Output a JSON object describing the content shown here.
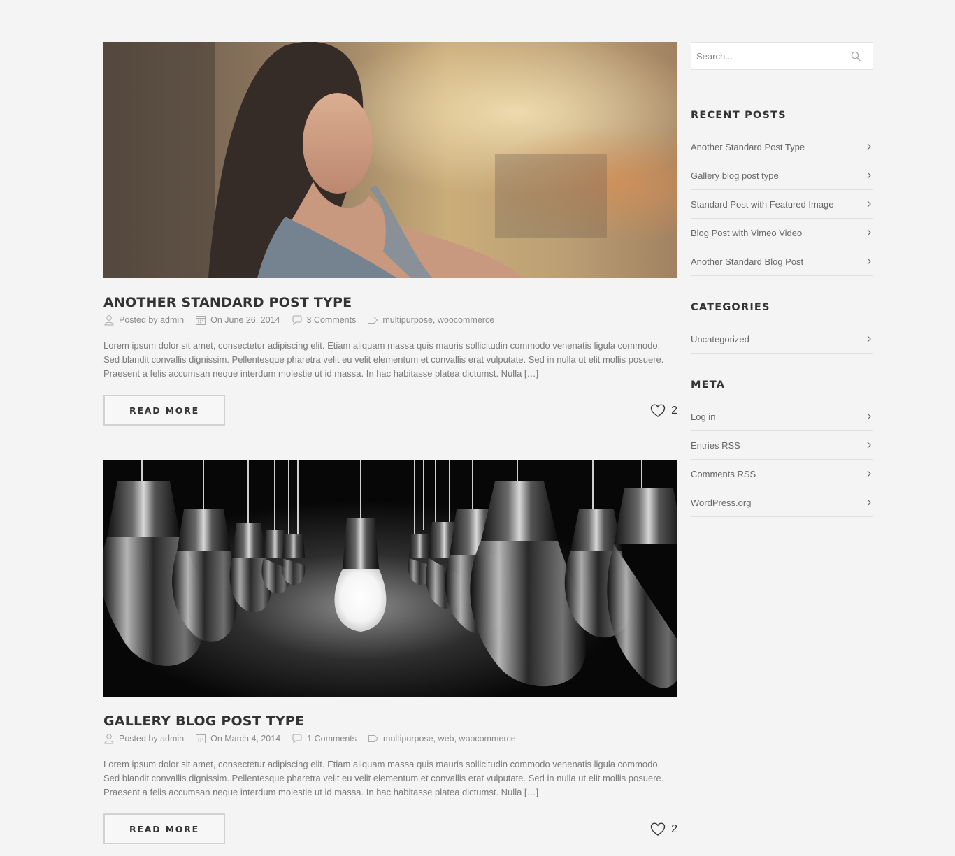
{
  "posts": [
    {
      "title": "Another Standard Post Type",
      "author": "Posted by admin",
      "date": "On June 26, 2014",
      "comments": "3 Comments",
      "tags": "multipurpose, woocommerce",
      "excerpt": "Lorem ipsum dolor sit amet, consectetur adipiscing elit. Etiam aliquam massa quis mauris sollicitudin commodo venenatis ligula commodo. Sed blandit convallis dignissim. Pellentesque pharetra velit eu velit elementum et convallis erat vulputate. Sed in nulla ut elit mollis posuere. Praesent a felis accumsan neque interdum molestie ut id massa. In hac habitasse platea dictumst. Nulla […]",
      "read_more": "READ MORE",
      "likes": "2"
    },
    {
      "title": "Gallery Blog Post Type",
      "author": "Posted by admin",
      "date": "On March 4, 2014",
      "comments": "1 Comments",
      "tags": "multipurpose, web, woocommerce",
      "excerpt": "Lorem ipsum dolor sit amet, consectetur adipiscing elit. Etiam aliquam massa quis mauris sollicitudin commodo venenatis ligula commodo. Sed blandit convallis dignissim. Pellentesque pharetra velit eu velit elementum et convallis erat vulputate. Sed in nulla ut elit mollis posuere. Praesent a felis accumsan neque interdum molestie ut id massa. In hac habitasse platea dictumst. Nulla […]",
      "read_more": "READ MORE",
      "likes": "2"
    }
  ],
  "sidebar": {
    "search_placeholder": "Search...",
    "recent_posts": {
      "title": "Recent Posts",
      "items": [
        "Another Standard Post Type",
        "Gallery blog post type",
        "Standard Post with Featured Image",
        "Blog Post with Vimeo Video",
        "Another Standard Blog Post"
      ]
    },
    "categories": {
      "title": "Categories",
      "items": [
        "Uncategorized"
      ]
    },
    "meta": {
      "title": "Meta",
      "items": [
        "Log in",
        "Entries RSS",
        "Comments RSS",
        "WordPress.org"
      ]
    }
  },
  "icons": {
    "user": "user-icon",
    "calendar": "calendar-icon",
    "comment": "comment-icon",
    "tag": "tag-icon",
    "heart": "heart-icon",
    "search": "search-icon",
    "chevron": "chevron-right-icon"
  },
  "colors": {
    "background": "#f4f4f4",
    "heading": "#333333",
    "text": "#777777",
    "divider": "#e0e0e0"
  }
}
